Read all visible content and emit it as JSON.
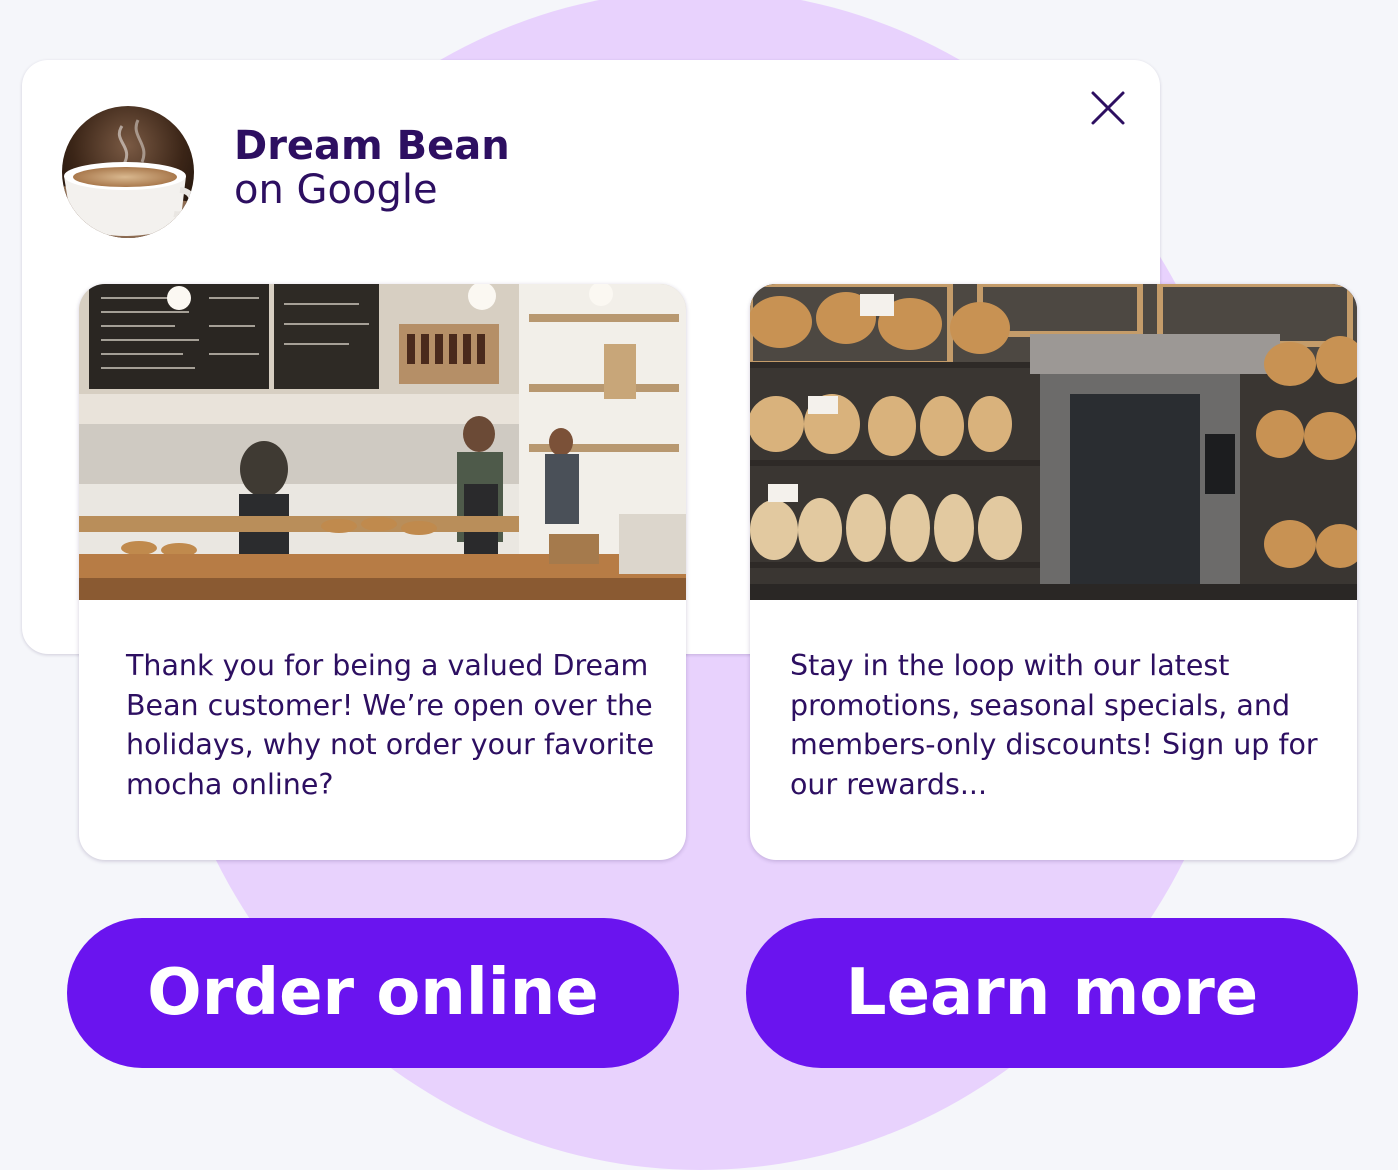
{
  "business": {
    "name": "Dream Bean",
    "platform": "on Google"
  },
  "posts": [
    {
      "image": "bakery-counter-photo",
      "text": "Thank you for being a valued Dream Bean customer! We’re open over the holidays, why not order your favorite mocha online?",
      "button_label": "Order online"
    },
    {
      "image": "bread-shelves-photo",
      "text": "Stay in the loop with our latest promotions, seasonal specials, and members-only discounts! Sign up for our rewards...",
      "button_label": "Learn more"
    }
  ],
  "icons": {
    "close": "close-icon"
  },
  "colors": {
    "accent": "#6a14ef",
    "text": "#2d0f61",
    "background_blob": "#e8d2fd",
    "card": "#ffffff"
  }
}
